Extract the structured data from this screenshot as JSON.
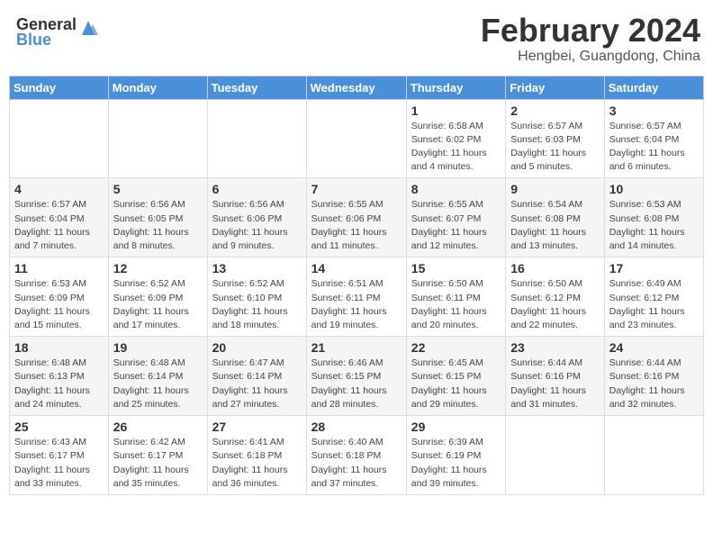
{
  "header": {
    "logo_general": "General",
    "logo_blue": "Blue",
    "month_year": "February 2024",
    "location": "Hengbei, Guangdong, China"
  },
  "weekdays": [
    "Sunday",
    "Monday",
    "Tuesday",
    "Wednesday",
    "Thursday",
    "Friday",
    "Saturday"
  ],
  "weeks": [
    [
      {
        "day": "",
        "info": ""
      },
      {
        "day": "",
        "info": ""
      },
      {
        "day": "",
        "info": ""
      },
      {
        "day": "",
        "info": ""
      },
      {
        "day": "1",
        "info": "Sunrise: 6:58 AM\nSunset: 6:02 PM\nDaylight: 11 hours and 4 minutes."
      },
      {
        "day": "2",
        "info": "Sunrise: 6:57 AM\nSunset: 6:03 PM\nDaylight: 11 hours and 5 minutes."
      },
      {
        "day": "3",
        "info": "Sunrise: 6:57 AM\nSunset: 6:04 PM\nDaylight: 11 hours and 6 minutes."
      }
    ],
    [
      {
        "day": "4",
        "info": "Sunrise: 6:57 AM\nSunset: 6:04 PM\nDaylight: 11 hours and 7 minutes."
      },
      {
        "day": "5",
        "info": "Sunrise: 6:56 AM\nSunset: 6:05 PM\nDaylight: 11 hours and 8 minutes."
      },
      {
        "day": "6",
        "info": "Sunrise: 6:56 AM\nSunset: 6:06 PM\nDaylight: 11 hours and 9 minutes."
      },
      {
        "day": "7",
        "info": "Sunrise: 6:55 AM\nSunset: 6:06 PM\nDaylight: 11 hours and 11 minutes."
      },
      {
        "day": "8",
        "info": "Sunrise: 6:55 AM\nSunset: 6:07 PM\nDaylight: 11 hours and 12 minutes."
      },
      {
        "day": "9",
        "info": "Sunrise: 6:54 AM\nSunset: 6:08 PM\nDaylight: 11 hours and 13 minutes."
      },
      {
        "day": "10",
        "info": "Sunrise: 6:53 AM\nSunset: 6:08 PM\nDaylight: 11 hours and 14 minutes."
      }
    ],
    [
      {
        "day": "11",
        "info": "Sunrise: 6:53 AM\nSunset: 6:09 PM\nDaylight: 11 hours and 15 minutes."
      },
      {
        "day": "12",
        "info": "Sunrise: 6:52 AM\nSunset: 6:09 PM\nDaylight: 11 hours and 17 minutes."
      },
      {
        "day": "13",
        "info": "Sunrise: 6:52 AM\nSunset: 6:10 PM\nDaylight: 11 hours and 18 minutes."
      },
      {
        "day": "14",
        "info": "Sunrise: 6:51 AM\nSunset: 6:11 PM\nDaylight: 11 hours and 19 minutes."
      },
      {
        "day": "15",
        "info": "Sunrise: 6:50 AM\nSunset: 6:11 PM\nDaylight: 11 hours and 20 minutes."
      },
      {
        "day": "16",
        "info": "Sunrise: 6:50 AM\nSunset: 6:12 PM\nDaylight: 11 hours and 22 minutes."
      },
      {
        "day": "17",
        "info": "Sunrise: 6:49 AM\nSunset: 6:12 PM\nDaylight: 11 hours and 23 minutes."
      }
    ],
    [
      {
        "day": "18",
        "info": "Sunrise: 6:48 AM\nSunset: 6:13 PM\nDaylight: 11 hours and 24 minutes."
      },
      {
        "day": "19",
        "info": "Sunrise: 6:48 AM\nSunset: 6:14 PM\nDaylight: 11 hours and 25 minutes."
      },
      {
        "day": "20",
        "info": "Sunrise: 6:47 AM\nSunset: 6:14 PM\nDaylight: 11 hours and 27 minutes."
      },
      {
        "day": "21",
        "info": "Sunrise: 6:46 AM\nSunset: 6:15 PM\nDaylight: 11 hours and 28 minutes."
      },
      {
        "day": "22",
        "info": "Sunrise: 6:45 AM\nSunset: 6:15 PM\nDaylight: 11 hours and 29 minutes."
      },
      {
        "day": "23",
        "info": "Sunrise: 6:44 AM\nSunset: 6:16 PM\nDaylight: 11 hours and 31 minutes."
      },
      {
        "day": "24",
        "info": "Sunrise: 6:44 AM\nSunset: 6:16 PM\nDaylight: 11 hours and 32 minutes."
      }
    ],
    [
      {
        "day": "25",
        "info": "Sunrise: 6:43 AM\nSunset: 6:17 PM\nDaylight: 11 hours and 33 minutes."
      },
      {
        "day": "26",
        "info": "Sunrise: 6:42 AM\nSunset: 6:17 PM\nDaylight: 11 hours and 35 minutes."
      },
      {
        "day": "27",
        "info": "Sunrise: 6:41 AM\nSunset: 6:18 PM\nDaylight: 11 hours and 36 minutes."
      },
      {
        "day": "28",
        "info": "Sunrise: 6:40 AM\nSunset: 6:18 PM\nDaylight: 11 hours and 37 minutes."
      },
      {
        "day": "29",
        "info": "Sunrise: 6:39 AM\nSunset: 6:19 PM\nDaylight: 11 hours and 39 minutes."
      },
      {
        "day": "",
        "info": ""
      },
      {
        "day": "",
        "info": ""
      }
    ]
  ]
}
